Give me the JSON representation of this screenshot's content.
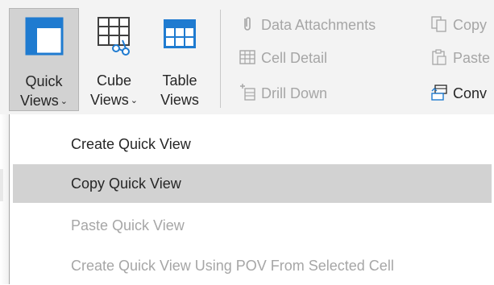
{
  "ribbon": {
    "quick_views": {
      "line1": "Quick",
      "line2": "Views",
      "chevron": "⌄",
      "icon": "quick-views-icon"
    },
    "cube_views": {
      "line1": "Cube",
      "line2": "Views",
      "chevron": "⌄",
      "icon": "cube-views-icon"
    },
    "table_views": {
      "line1": "Table",
      "line2": "Views",
      "icon": "table-views-icon"
    },
    "small_buttons": {
      "data_attachments": "Data Attachments",
      "cell_detail": "Cell Detail",
      "drill_down": "Drill Down",
      "copy": "Copy",
      "paste": "Paste",
      "convert": "Conv"
    }
  },
  "menu": {
    "items": [
      {
        "label": "Create Quick View",
        "enabled": true
      },
      {
        "label": "Copy Quick View",
        "enabled": true,
        "highlighted": true
      },
      {
        "label": "Paste Quick View",
        "enabled": false
      },
      {
        "label": "Create Quick View Using POV From Selected Cell",
        "enabled": false
      }
    ]
  },
  "colors": {
    "ribbon_bg": "#f3f3f3",
    "active_bg": "#d2d2d2",
    "accent_blue": "#1f7bd0",
    "disabled_text": "#a6a6a6",
    "text": "#262626"
  }
}
